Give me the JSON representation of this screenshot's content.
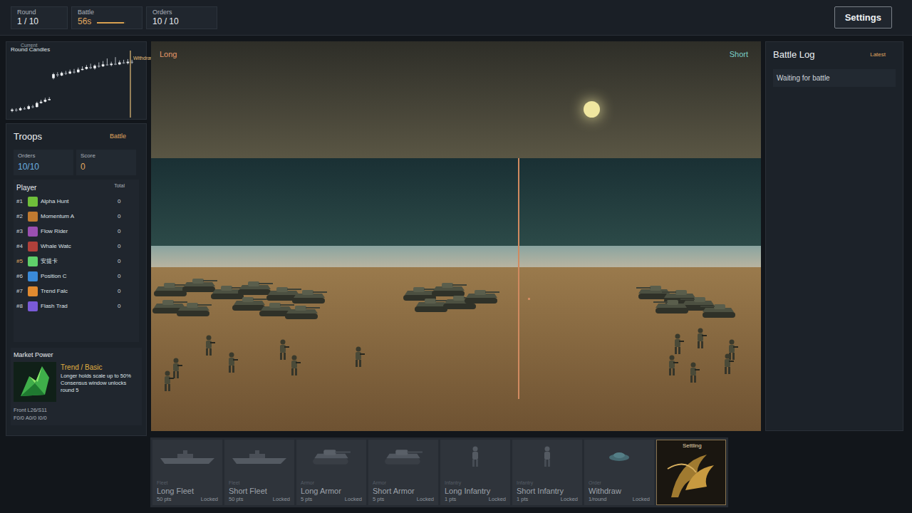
{
  "top_bar": {
    "stats": [
      {
        "label": "Round",
        "value": "1 / 10",
        "accent": false
      },
      {
        "label": "Battle",
        "value": "56s",
        "accent": true,
        "level": 0.95
      },
      {
        "label": "Orders",
        "value": "10 / 10",
        "accent": false
      }
    ],
    "settings_button": "Settings"
  },
  "chart": {
    "title": "Round Candles",
    "current_label": "Current",
    "marker_label": "Withdraw",
    "candles": [
      [
        8,
        10,
        12,
        6
      ],
      [
        10,
        9,
        12,
        7
      ],
      [
        9,
        12,
        14,
        8
      ],
      [
        12,
        11,
        14,
        10
      ],
      [
        11,
        15,
        17,
        10
      ],
      [
        15,
        14,
        17,
        12
      ],
      [
        14,
        20,
        22,
        13
      ],
      [
        20,
        22,
        25,
        19
      ],
      [
        22,
        25,
        28,
        21
      ],
      [
        25,
        26,
        29,
        24
      ],
      [
        58,
        64,
        66,
        56
      ],
      [
        64,
        62,
        67,
        60
      ],
      [
        62,
        66,
        68,
        61
      ],
      [
        66,
        65,
        69,
        63
      ],
      [
        65,
        68,
        71,
        64
      ],
      [
        68,
        67,
        72,
        65
      ],
      [
        67,
        71,
        74,
        66
      ],
      [
        71,
        72,
        76,
        70
      ],
      [
        72,
        75,
        78,
        71
      ],
      [
        75,
        73,
        80,
        72
      ],
      [
        73,
        77,
        79,
        71
      ],
      [
        77,
        76,
        82,
        74
      ],
      [
        76,
        79,
        84,
        75
      ],
      [
        79,
        78,
        88,
        77
      ],
      [
        78,
        80,
        83,
        76
      ],
      [
        80,
        79,
        90,
        78
      ],
      [
        79,
        82,
        85,
        78
      ],
      [
        82,
        81,
        86,
        80
      ],
      [
        81,
        83,
        87,
        79
      ],
      [
        83,
        82,
        86,
        80
      ]
    ]
  },
  "troops": {
    "title": "Troops",
    "status": "Battle",
    "orders": {
      "label": "Orders",
      "value": "10/10"
    },
    "score": {
      "label": "Score",
      "value": "0"
    },
    "player_header": "Player",
    "total_header": "Total",
    "players": [
      {
        "rank": "#1",
        "name": "Alpha Hunt",
        "total": "0",
        "selected": false,
        "color": "#6fbf3a"
      },
      {
        "rank": "#2",
        "name": "Momentum A",
        "total": "0",
        "selected": false,
        "color": "#c07a30"
      },
      {
        "rank": "#3",
        "name": "Flow Rider",
        "total": "0",
        "selected": false,
        "color": "#9a4fb0"
      },
      {
        "rank": "#4",
        "name": "Whale Watc",
        "total": "0",
        "selected": false,
        "color": "#b0403a"
      },
      {
        "rank": "#5",
        "name": "安提卡",
        "total": "0",
        "selected": true,
        "color": "#5fd06a"
      },
      {
        "rank": "#6",
        "name": "Position C",
        "total": "0",
        "selected": false,
        "color": "#3a8ad8"
      },
      {
        "rank": "#7",
        "name": "Trend Falc",
        "total": "0",
        "selected": false,
        "color": "#e08a30"
      },
      {
        "rank": "#8",
        "name": "Flash Trad",
        "total": "0",
        "selected": false,
        "color": "#7a5ad8"
      }
    ]
  },
  "market_power": {
    "title": "Market Power",
    "name": "Trend / Basic",
    "lines": [
      "Longer holds scale up to 50%",
      "Consensus window unlocks round 5"
    ],
    "front": "Front L26/S11",
    "forces": "F0/0 A0/0 I0/0"
  },
  "battlefield": {
    "long_label": "Long",
    "short_label": "Short",
    "groups": [
      {
        "side": "long",
        "tanks": 11,
        "infantry": 7
      },
      {
        "side": "center",
        "tanks": 5,
        "infantry": 0
      },
      {
        "side": "short",
        "tanks": 5,
        "infantry": 6
      }
    ]
  },
  "battle_log": {
    "title": "Battle Log",
    "filter": "Latest",
    "entries": [
      "Waiting for battle"
    ]
  },
  "cards": [
    {
      "kind": "fleet",
      "category": "Fleet",
      "name": "Long Fleet",
      "cost": "50 pts",
      "status": "Locked",
      "disabled": true
    },
    {
      "kind": "fleet",
      "category": "Fleet",
      "name": "Short Fleet",
      "cost": "50 pts",
      "status": "Locked",
      "disabled": true
    },
    {
      "kind": "armor",
      "category": "Armor",
      "name": "Long Armor",
      "cost": "5 pts",
      "status": "Locked",
      "disabled": true
    },
    {
      "kind": "armor",
      "category": "Armor",
      "name": "Short Armor",
      "cost": "5 pts",
      "status": "Locked",
      "disabled": true
    },
    {
      "kind": "infantry",
      "category": "Infantry",
      "name": "Long Infantry",
      "cost": "1 pts",
      "status": "Locked",
      "disabled": true
    },
    {
      "kind": "infantry",
      "category": "Infantry",
      "name": "Short Infantry",
      "cost": "1 pts",
      "status": "Locked",
      "disabled": true
    },
    {
      "kind": "order",
      "category": "Order",
      "name": "Withdraw",
      "cost": "1/round",
      "status": "Locked",
      "disabled": true
    },
    {
      "kind": "settling",
      "category": "Settling",
      "name": "",
      "cost": "",
      "status": "",
      "disabled": false
    }
  ]
}
